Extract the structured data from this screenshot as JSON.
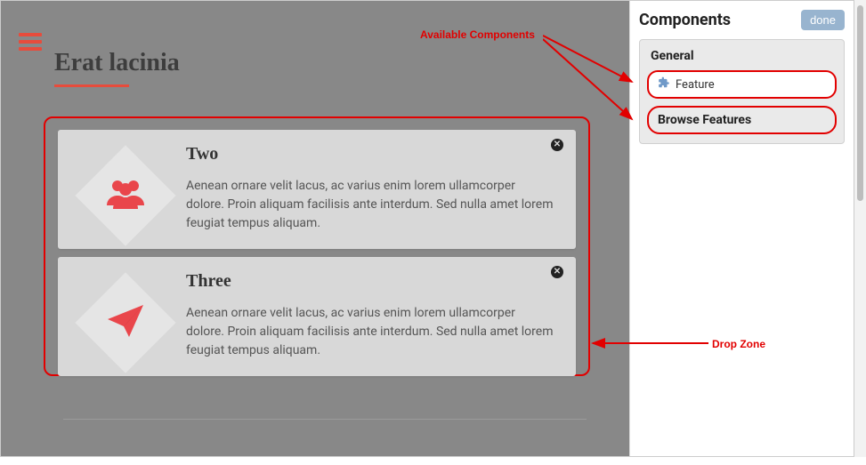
{
  "page": {
    "title": "Erat lacinia"
  },
  "cards": [
    {
      "title": "Two",
      "text": "Aenean ornare velit lacus, ac varius enim lorem ullamcorper dolore. Proin aliquam facilisis ante interdum. Sed nulla amet lorem feugiat tempus aliquam.",
      "icon": "users-icon"
    },
    {
      "title": "Three",
      "text": "Aenean ornare velit lacus, ac varius enim lorem ullamcorper dolore. Proin aliquam facilisis ante interdum. Sed nulla amet lorem feugiat tempus aliquam.",
      "icon": "paper-plane-icon"
    }
  ],
  "panel": {
    "title": "Components",
    "done_label": "done",
    "category_label": "General",
    "feature_label": "Feature",
    "browse_label": "Browse Features"
  },
  "annotations": {
    "available": "Available Components",
    "dropzone": "Drop Zone"
  },
  "colors": {
    "accent": "#e9464b",
    "annotation": "#e20000",
    "done_button": "#98b4cf"
  }
}
